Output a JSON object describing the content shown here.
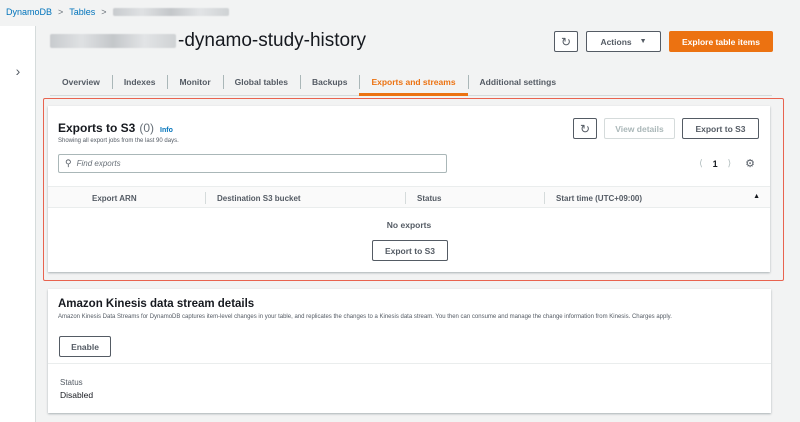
{
  "breadcrumb": {
    "service": "DynamoDB",
    "tables": "Tables",
    "separator": ">"
  },
  "header": {
    "title_suffix": "-dynamo-study-history",
    "refresh_icon": "refresh-icon",
    "actions_label": "Actions",
    "explore_label": "Explore table items"
  },
  "tabs": [
    {
      "label": "Overview"
    },
    {
      "label": "Indexes"
    },
    {
      "label": "Monitor"
    },
    {
      "label": "Global tables"
    },
    {
      "label": "Backups"
    },
    {
      "label": "Exports and streams",
      "active": true
    },
    {
      "label": "Additional settings"
    }
  ],
  "exports": {
    "title": "Exports to S3",
    "count": "(0)",
    "info": "Info",
    "description": "Showing all export jobs from the last 90 days.",
    "view_details_label": "View details",
    "export_label": "Export to S3",
    "search_placeholder": "Find exports",
    "page_number": "1",
    "columns": [
      "Export ARN",
      "Destination S3 bucket",
      "Status",
      "Start time (UTC+09:00)"
    ],
    "empty_text": "No exports",
    "empty_button_label": "Export to S3"
  },
  "kinesis": {
    "title": "Amazon Kinesis data stream details",
    "description": "Amazon Kinesis Data Streams for DynamoDB captures item-level changes in your table, and replicates the changes to a Kinesis data stream. You then can consume and manage the change information from Kinesis. Charges apply.",
    "enable_label": "Enable",
    "status_label": "Status",
    "status_value": "Disabled"
  },
  "colors": {
    "accent": "#ec7211",
    "link": "#0073bb",
    "highlight_border": "#e8634f"
  }
}
